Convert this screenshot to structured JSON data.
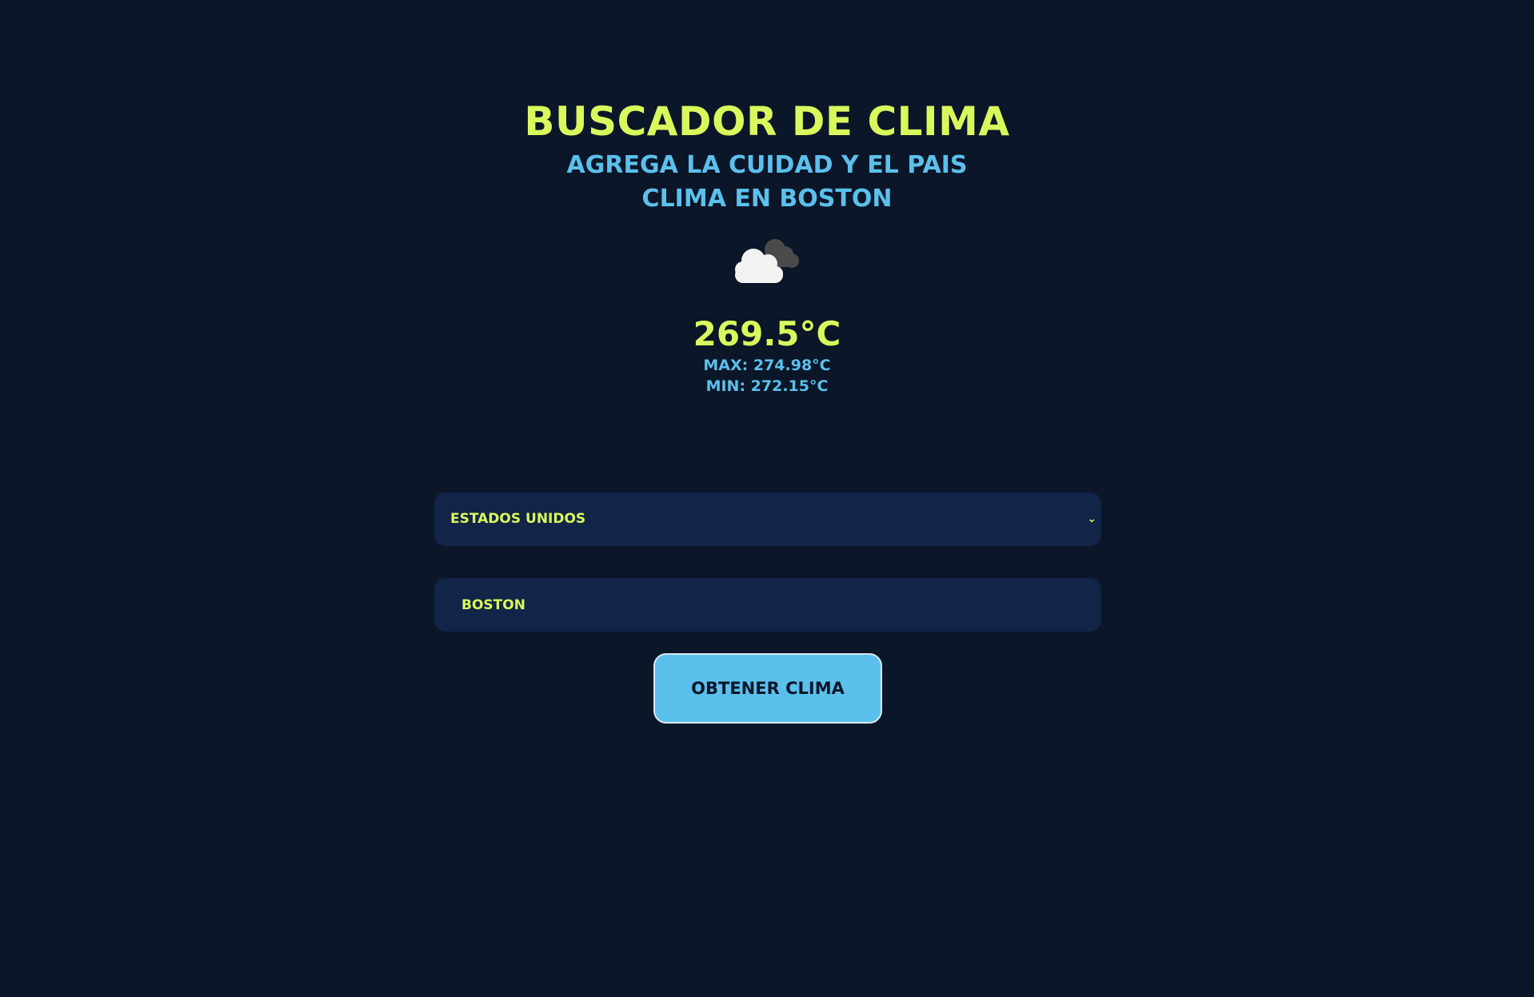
{
  "header": {
    "title": "BUSCADOR DE CLIMA",
    "subtitle": "AGREGA LA CUIDAD Y EL PAIS",
    "city_heading": "CLIMA EN BOSTON"
  },
  "weather": {
    "icon": "cloud-icon",
    "temperature": "269.5°C",
    "max": "MAX: 274.98°C",
    "min": "MIN: 272.15°C"
  },
  "form": {
    "country_select": {
      "selected": "ESTADOS UNIDOS",
      "chevron": "⌄"
    },
    "city_input": {
      "value": "BOSTON",
      "placeholder": ""
    },
    "submit_label": "OBTENER CLIMA"
  },
  "colors": {
    "background": "#0b1629",
    "accent_yellow": "#d9f85c",
    "accent_blue": "#5bc0eb",
    "field_bg": "#122447"
  }
}
